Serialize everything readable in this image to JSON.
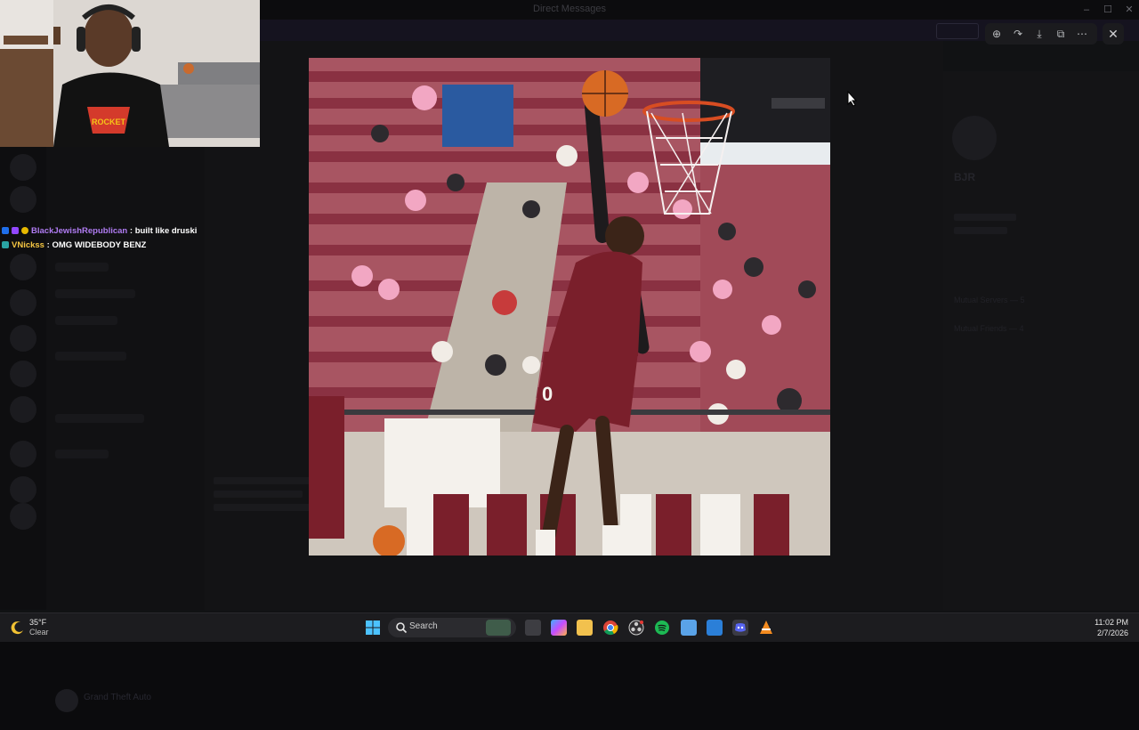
{
  "window": {
    "title": "Direct Messages",
    "controls": [
      "minimize-icon",
      "maximize-icon",
      "close-icon"
    ]
  },
  "banner": {
    "text": "",
    "button_label": ""
  },
  "stream_chat": [
    {
      "user": "BlackJewishRepublican",
      "user_color": "#b07cf2",
      "message": "built like druski"
    },
    {
      "user": "VNickss",
      "user_color": "#f4c542",
      "message": "OMG WIDEBODY BENZ"
    }
  ],
  "profile_panel": {
    "name": "BJR",
    "links": [
      "Mutual Servers — 5",
      "Mutual Friends — 4"
    ]
  },
  "background_server": {
    "title": "Grand Theft Auto"
  },
  "image_viewer": {
    "toolbar": [
      "zoom-in-icon",
      "rotate-icon",
      "download-icon",
      "open-external-icon",
      "more-icon"
    ],
    "close": "close-icon",
    "image_alt": "Basketball player in maroon jersey dunking in a gymnasium"
  },
  "taskbar": {
    "weather": {
      "temp": "35°F",
      "condition": "Clear"
    },
    "search_placeholder": "Search",
    "apps": [
      "windows-start",
      "search",
      "task-view",
      "copilot",
      "file-explorer",
      "chrome",
      "obs",
      "spotify",
      "notepad",
      "snipping-tool",
      "discord",
      "vlc"
    ],
    "time": "11:02 PM",
    "date": "2/7/2026"
  },
  "colors": {
    "accent": "#5865f2",
    "jersey": "#7a1f2b"
  }
}
